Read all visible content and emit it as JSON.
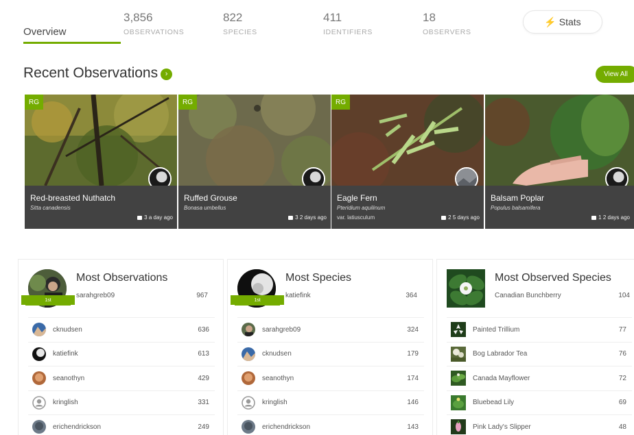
{
  "tabs": {
    "overview": "Overview",
    "observations": {
      "value": "3,856",
      "label": "OBSERVATIONS"
    },
    "species": {
      "value": "822",
      "label": "SPECIES"
    },
    "identifiers": {
      "value": "411",
      "label": "IDENTIFIERS"
    },
    "observers": {
      "value": "18",
      "label": "OBSERVERS"
    },
    "stats_button": "Stats"
  },
  "recent": {
    "title": "Recent Observations",
    "view_all": "View All",
    "cards": [
      {
        "badge": "RG",
        "common": "Red-breasted Nuthatch",
        "scientific": "Sitta canadensis",
        "variety": "",
        "comments": "3",
        "ago": "a day ago"
      },
      {
        "badge": "RG",
        "common": "Ruffed Grouse",
        "scientific": "Bonasa umbellus",
        "variety": "",
        "comments": "3",
        "ago": "2 days ago"
      },
      {
        "badge": "RG",
        "common": "Eagle Fern",
        "scientific": "Pteridium aquilinum",
        "variety": "var. latiusculum",
        "comments": "2",
        "ago": "5 days ago"
      },
      {
        "badge": "",
        "common": "Balsam Poplar",
        "scientific": "Populus balsamifera",
        "variety": "",
        "comments": "1",
        "ago": "2 days ago"
      }
    ]
  },
  "most_observations": {
    "title": "Most Observations",
    "rank": "1st",
    "leader": {
      "name": "sarahgreb09",
      "count": "967"
    },
    "rows": [
      {
        "name": "cknudsen",
        "count": "636"
      },
      {
        "name": "katiefink",
        "count": "613"
      },
      {
        "name": "seanothyn",
        "count": "429"
      },
      {
        "name": "kringlish",
        "count": "331"
      },
      {
        "name": "erichendrickson",
        "count": "249"
      }
    ]
  },
  "most_species": {
    "title": "Most Species",
    "rank": "1st",
    "leader": {
      "name": "katiefink",
      "count": "364"
    },
    "rows": [
      {
        "name": "sarahgreb09",
        "count": "324"
      },
      {
        "name": "cknudsen",
        "count": "179"
      },
      {
        "name": "seanothyn",
        "count": "174"
      },
      {
        "name": "kringlish",
        "count": "146"
      },
      {
        "name": "erichendrickson",
        "count": "143"
      }
    ]
  },
  "most_observed_species": {
    "title": "Most Observed Species",
    "leader": {
      "name": "Canadian Bunchberry",
      "count": "104"
    },
    "rows": [
      {
        "name": "Painted Trillium",
        "count": "77"
      },
      {
        "name": "Bog Labrador Tea",
        "count": "76"
      },
      {
        "name": "Canada Mayflower",
        "count": "72"
      },
      {
        "name": "Bluebead Lily",
        "count": "69"
      },
      {
        "name": "Pink Lady's Slipper",
        "count": "48"
      }
    ]
  },
  "colors": {
    "accent": "#74ac00",
    "card_footer": "#424242"
  },
  "icons": {
    "stats": "bolt-icon",
    "recent": "arrow-right-circle-icon",
    "comments": "comment-icon",
    "placeholder_user": "user-circle-icon"
  }
}
